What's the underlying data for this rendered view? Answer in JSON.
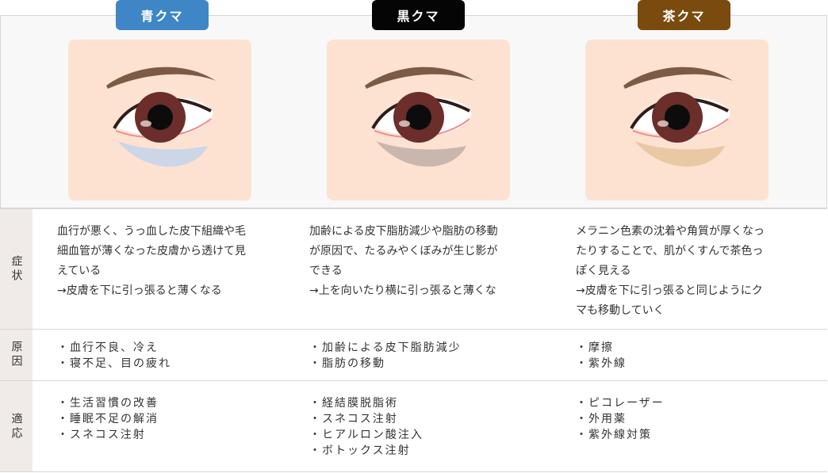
{
  "columns": [
    {
      "title": "青クマ",
      "color": "#3f86c6"
    },
    {
      "title": "黒クマ",
      "color": "#050505"
    },
    {
      "title": "茶クマ",
      "color": "#7a4a0f"
    }
  ],
  "rows": {
    "symptom": {
      "label": "症状",
      "cells": [
        "血行が悪く、うっ血した皮下組織や毛\n細血管が薄くなった皮膚から透けて見\nえている\n→皮膚を下に引っ張ると薄くなる",
        "加齢による皮下脂肪減少や脂肪の移動\nが原因で、たるみやくぼみが生じ影が\nできる\n→上を向いたり横に引っ張ると薄くな",
        "メラニン色素の沈着や角質が厚くなっ\nたりすることで、肌がくすんで茶色っ\nぽく見える\n→皮膚を下に引っ張ると同じようにク\nマも移動していく"
      ]
    },
    "cause": {
      "label": "原因",
      "cells": [
        "・血行不良、冷え\n・寝不足、目の疲れ",
        "・加齢による皮下脂肪減少\n・脂肪の移動",
        "・摩擦\n・紫外線"
      ]
    },
    "treatment": {
      "label": "適応",
      "cells": [
        "・生活習慣の改善\n・睡眠不足の解消\n・スネコス注射",
        "・経結膜脱脂術\n・スネコス注射\n・ヒアルロン酸注入\n・ボトックス注射",
        "・ピコレーザー\n・外用薬\n・紫外線対策"
      ]
    }
  },
  "eye_shadow_colors": [
    "#cdd6e6",
    "#c9b7ad",
    "#e9c8a4"
  ]
}
